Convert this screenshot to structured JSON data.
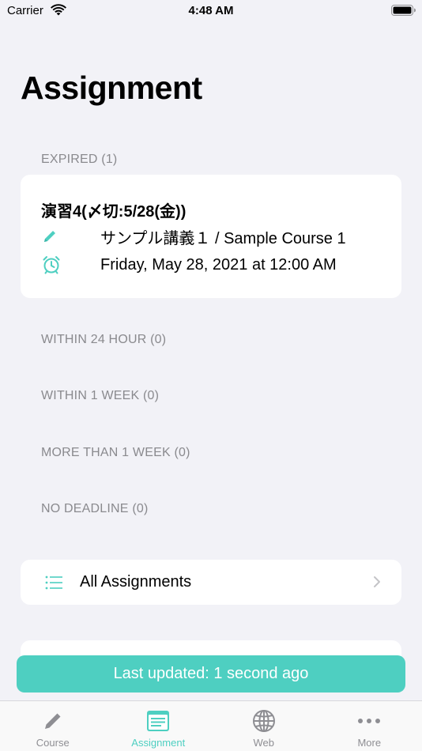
{
  "status_bar": {
    "carrier": "Carrier",
    "time": "4:48 AM"
  },
  "page_title": "Assignment",
  "sections": {
    "expired": "EXPIRED (1)",
    "within_24_hour": "WITHIN 24 HOUR (0)",
    "within_1_week": "WITHIN 1 WEEK (0)",
    "more_than_1_week": "MORE THAN 1 WEEK (0)",
    "no_deadline": "NO DEADLINE (0)"
  },
  "assignment": {
    "title": "演習4(〆切:5/28(金))",
    "course": "サンプル講義１ / Sample Course 1",
    "deadline": "Friday, May 28, 2021 at 12:00 AM"
  },
  "all_assignments_label": "All Assignments",
  "toast": "Last updated: 1 second ago",
  "tabs": [
    {
      "label": "Course",
      "icon": "pencil-icon",
      "active": false
    },
    {
      "label": "Assignment",
      "icon": "assignment-icon",
      "active": true
    },
    {
      "label": "Web",
      "icon": "globe-icon",
      "active": false
    },
    {
      "label": "More",
      "icon": "more-icon",
      "active": false
    }
  ],
  "colors": {
    "accent": "#4ecfc1",
    "background": "#f2f2f7",
    "section_text": "#8a8a8e",
    "inactive_tab": "#8e8e93"
  }
}
